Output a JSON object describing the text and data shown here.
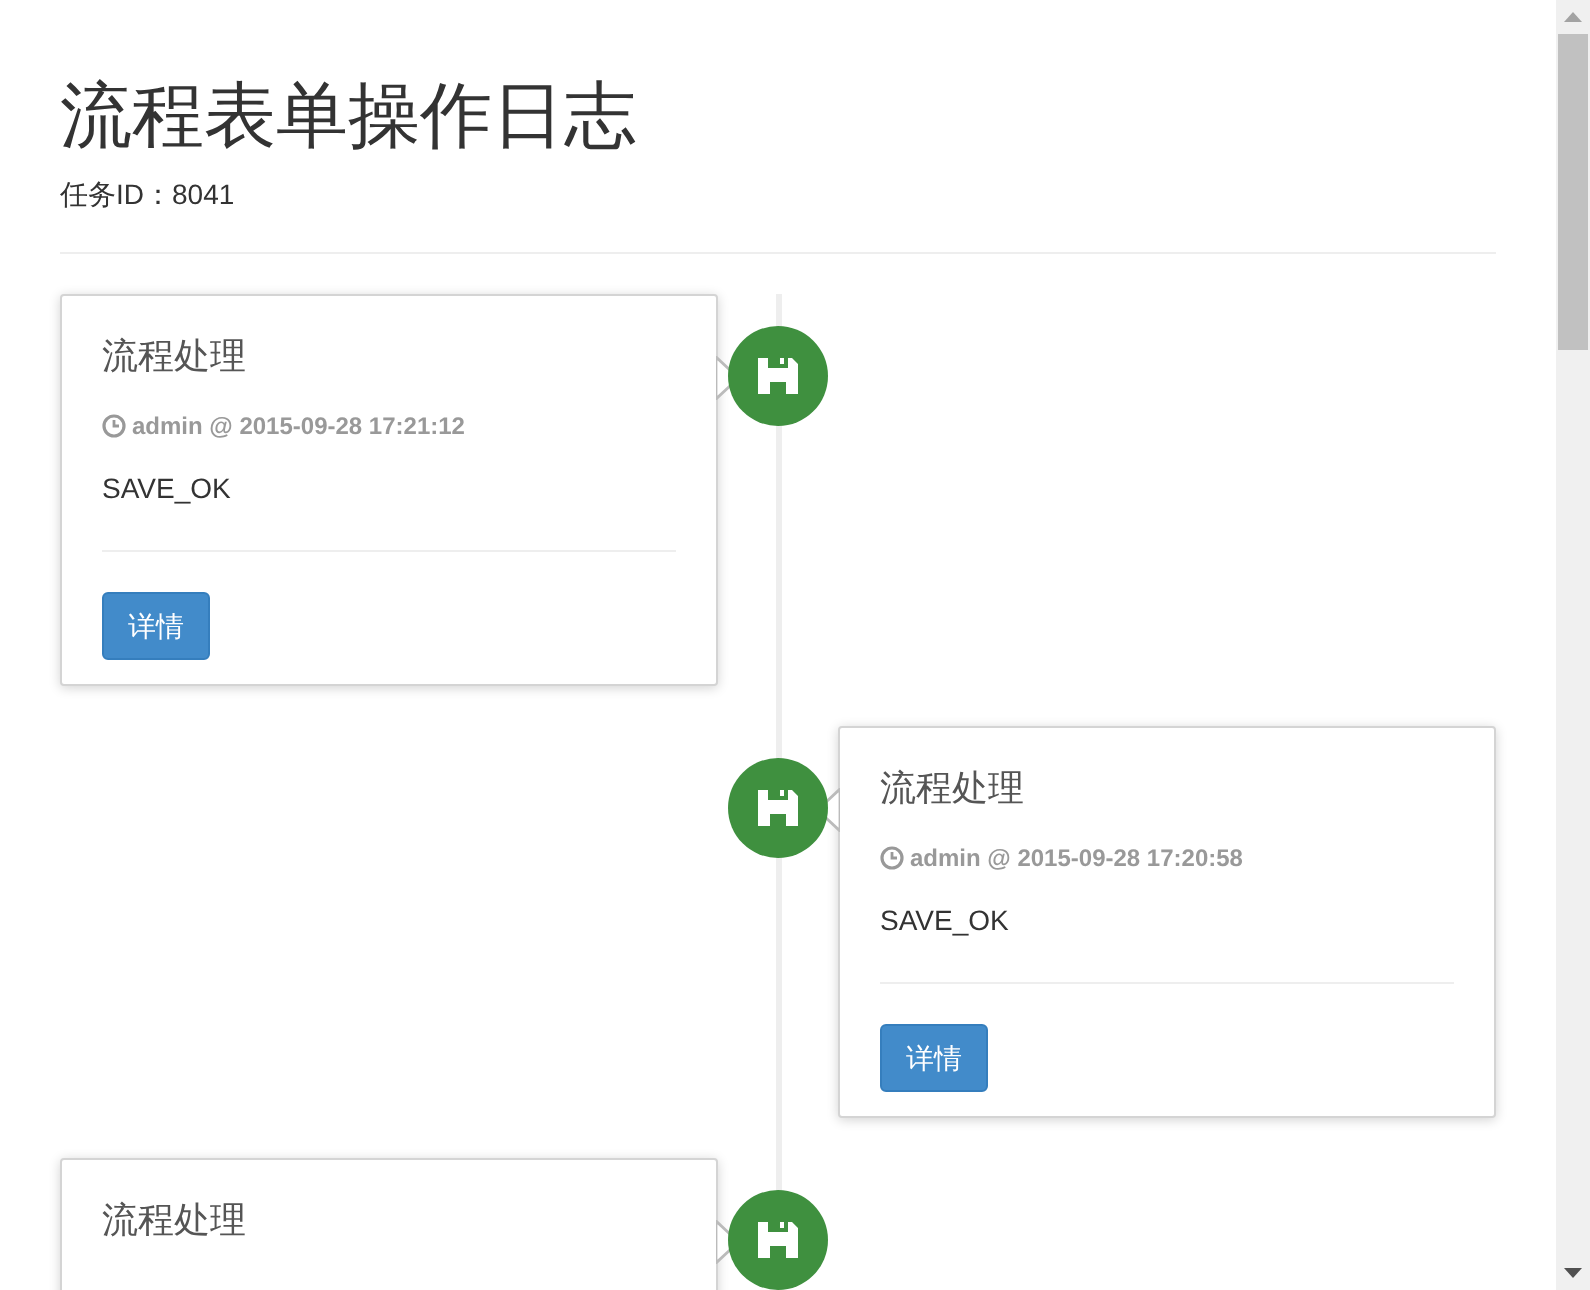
{
  "page": {
    "title": "流程表单操作日志",
    "subtitle": "任务ID：8041"
  },
  "timeline": [
    {
      "kind": "left",
      "color": "#3f903f",
      "title": "流程处理",
      "meta": "admin @ 2015-09-28 17:21:12",
      "body": "SAVE_OK",
      "button": "详情"
    },
    {
      "kind": "right",
      "color": "#3f903f",
      "title": "流程处理",
      "meta": "admin @ 2015-09-28 17:20:58",
      "body": "SAVE_OK",
      "button": "详情"
    },
    {
      "kind": "left",
      "color": "#3f903f",
      "title": "流程处理"
    }
  ]
}
